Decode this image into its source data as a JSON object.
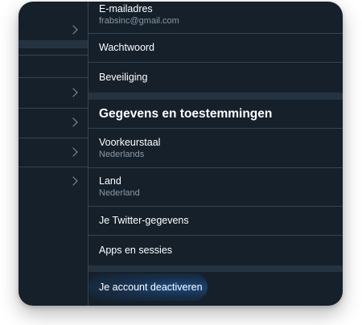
{
  "account": {
    "email": {
      "label": "E-mailadres",
      "value": "frabsinc@gmail.com"
    },
    "password_label": "Wachtwoord",
    "security_label": "Beveiliging"
  },
  "data_permissions": {
    "heading": "Gegevens en toestemmingen",
    "preferred_language": {
      "label": "Voorkeurstaal",
      "value": "Nederlands"
    },
    "country": {
      "label": "Land",
      "value": "Nederland"
    },
    "twitter_data_label": "Je Twitter-gegevens",
    "apps_sessions_label": "Apps en sessies"
  },
  "deactivate_label": "Je account deactiveren",
  "colors": {
    "background": "#15202b",
    "divider": "#38444d",
    "band": "#253341",
    "primary_text": "#ffffff",
    "secondary_text": "#8899a6",
    "accent": "#1d9bf0"
  }
}
